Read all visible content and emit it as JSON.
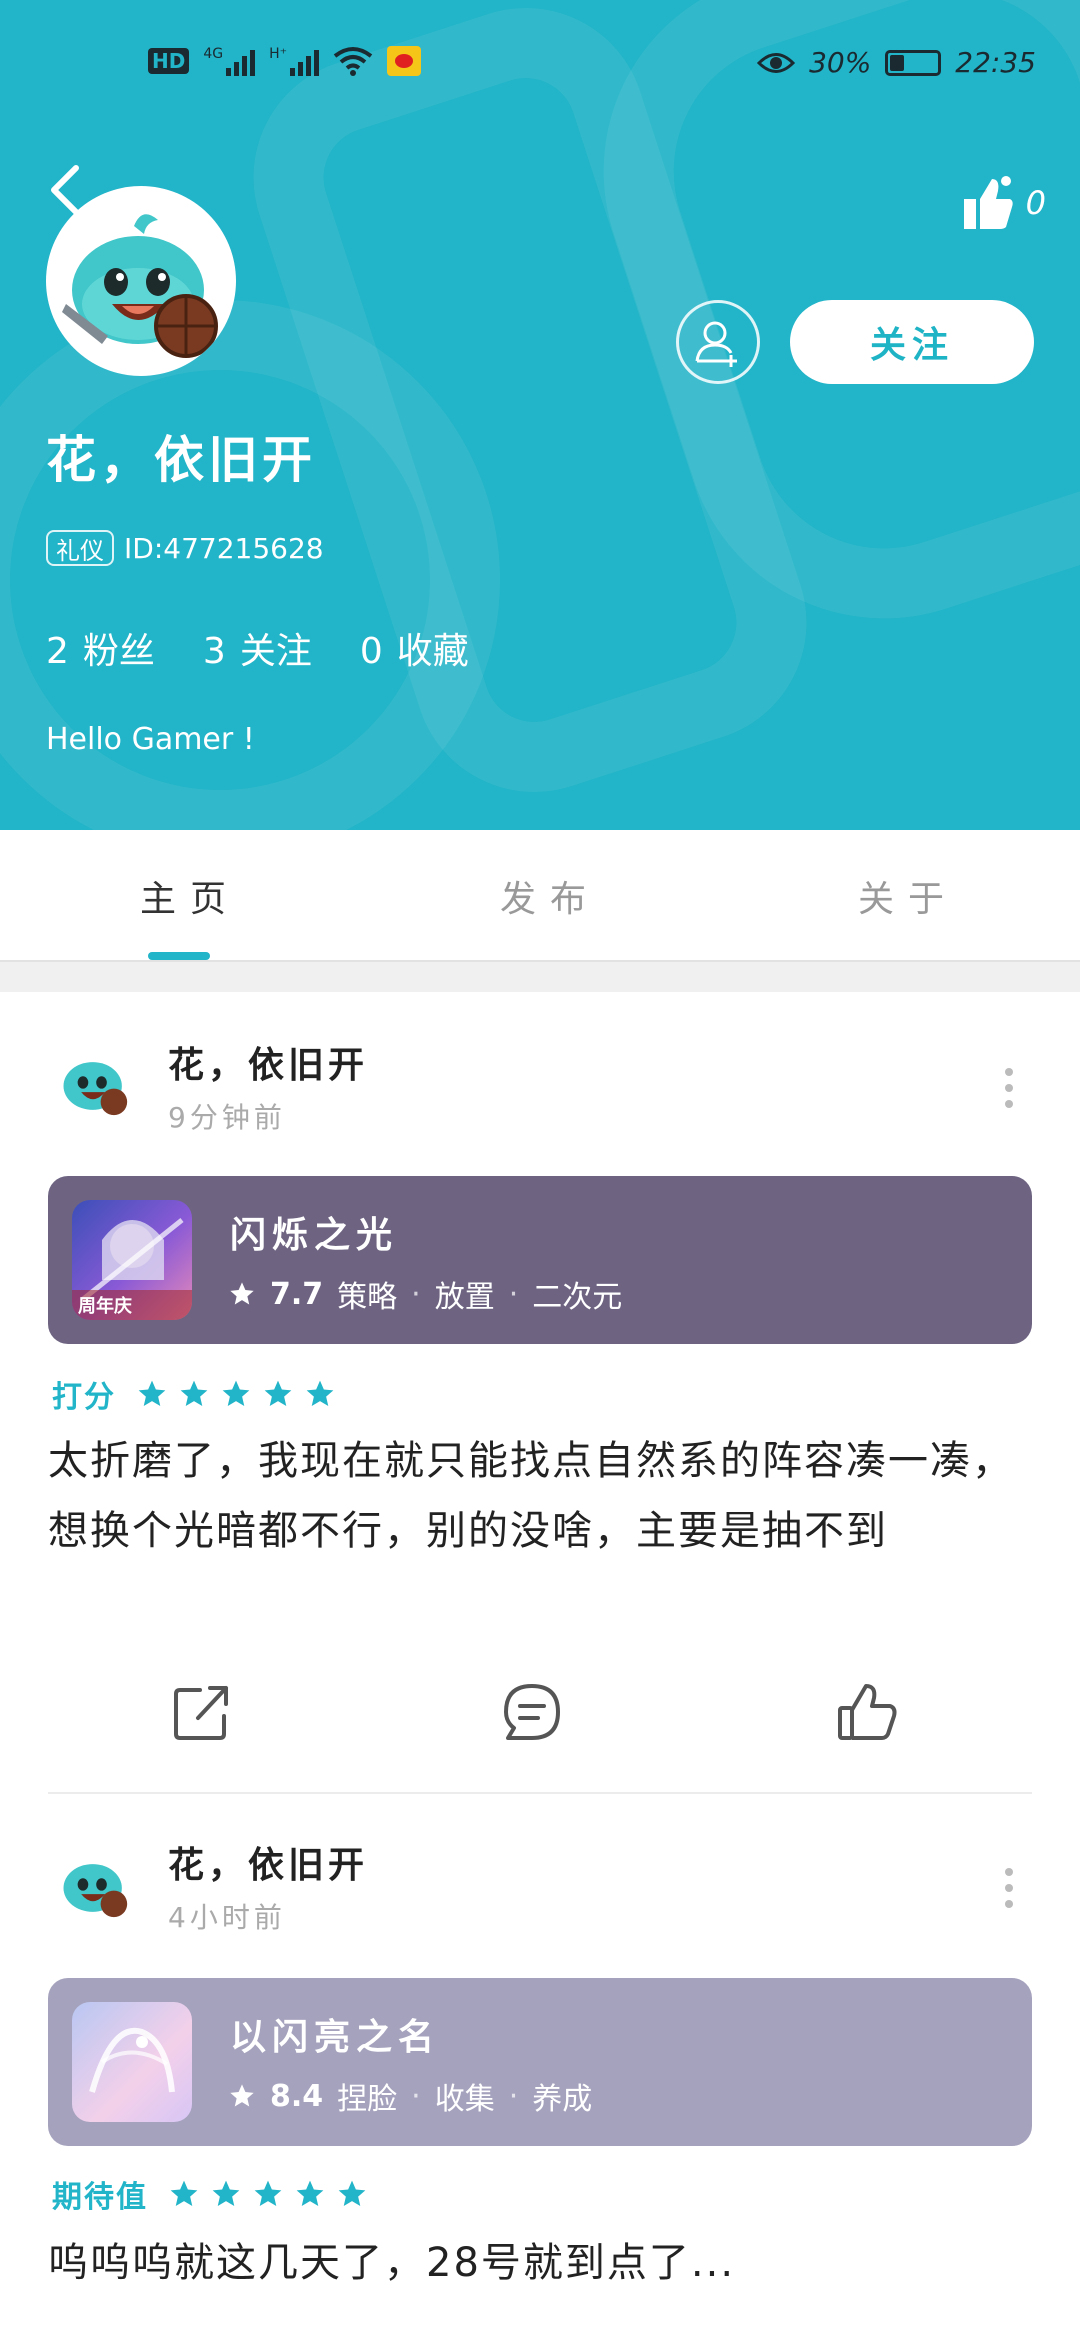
{
  "status_bar": {
    "left_icons": [
      "hd-icon",
      "4g-signal-icon",
      "h-plus-signal-icon",
      "wifi-icon",
      "weibo-icon"
    ],
    "left_text": {
      "hd": "HD",
      "net1": "4G",
      "net2": "H⁺"
    },
    "battery_percent_text": "30%",
    "battery_level": 0.3,
    "time": "22:35"
  },
  "profile": {
    "like_count": "0",
    "follow_label": "关注",
    "nickname": "花，依旧开",
    "badge": "礼仪",
    "id_text": "ID:477215628",
    "stats": [
      {
        "num": "2",
        "label": "粉丝"
      },
      {
        "num": "3",
        "label": "关注"
      },
      {
        "num": "0",
        "label": "收藏"
      }
    ],
    "bio": "Hello Gamer !"
  },
  "tabs": [
    {
      "label": "主页",
      "active": true
    },
    {
      "label": "发布",
      "active": false
    },
    {
      "label": "关于",
      "active": false
    }
  ],
  "posts": [
    {
      "author": "花，依旧开",
      "time": "9分钟前",
      "game": {
        "title": "闪烁之光",
        "score": "7.7",
        "tags": [
          "策略",
          "放置",
          "二次元"
        ],
        "icon_badge": "周年庆",
        "card_color": "#6e6482"
      },
      "rating_label": "打分",
      "stars": 5,
      "text": "太折磨了，我现在就只能找点自然系的阵容凑一凑，想换个光暗都不行，别的没啥，主要是抽不到"
    },
    {
      "author": "花，依旧开",
      "time": "4小时前",
      "game": {
        "title": "以闪亮之名",
        "score": "8.4",
        "tags": [
          "捏脸",
          "收集",
          "养成"
        ],
        "card_color": "#a5a2bd"
      },
      "rating_label": "期待值",
      "stars": 5,
      "text": "呜呜呜就这几天了，28号就到点了..."
    }
  ],
  "colors": {
    "accent": "#22b4c8",
    "header_bg": "#22b4c8"
  }
}
